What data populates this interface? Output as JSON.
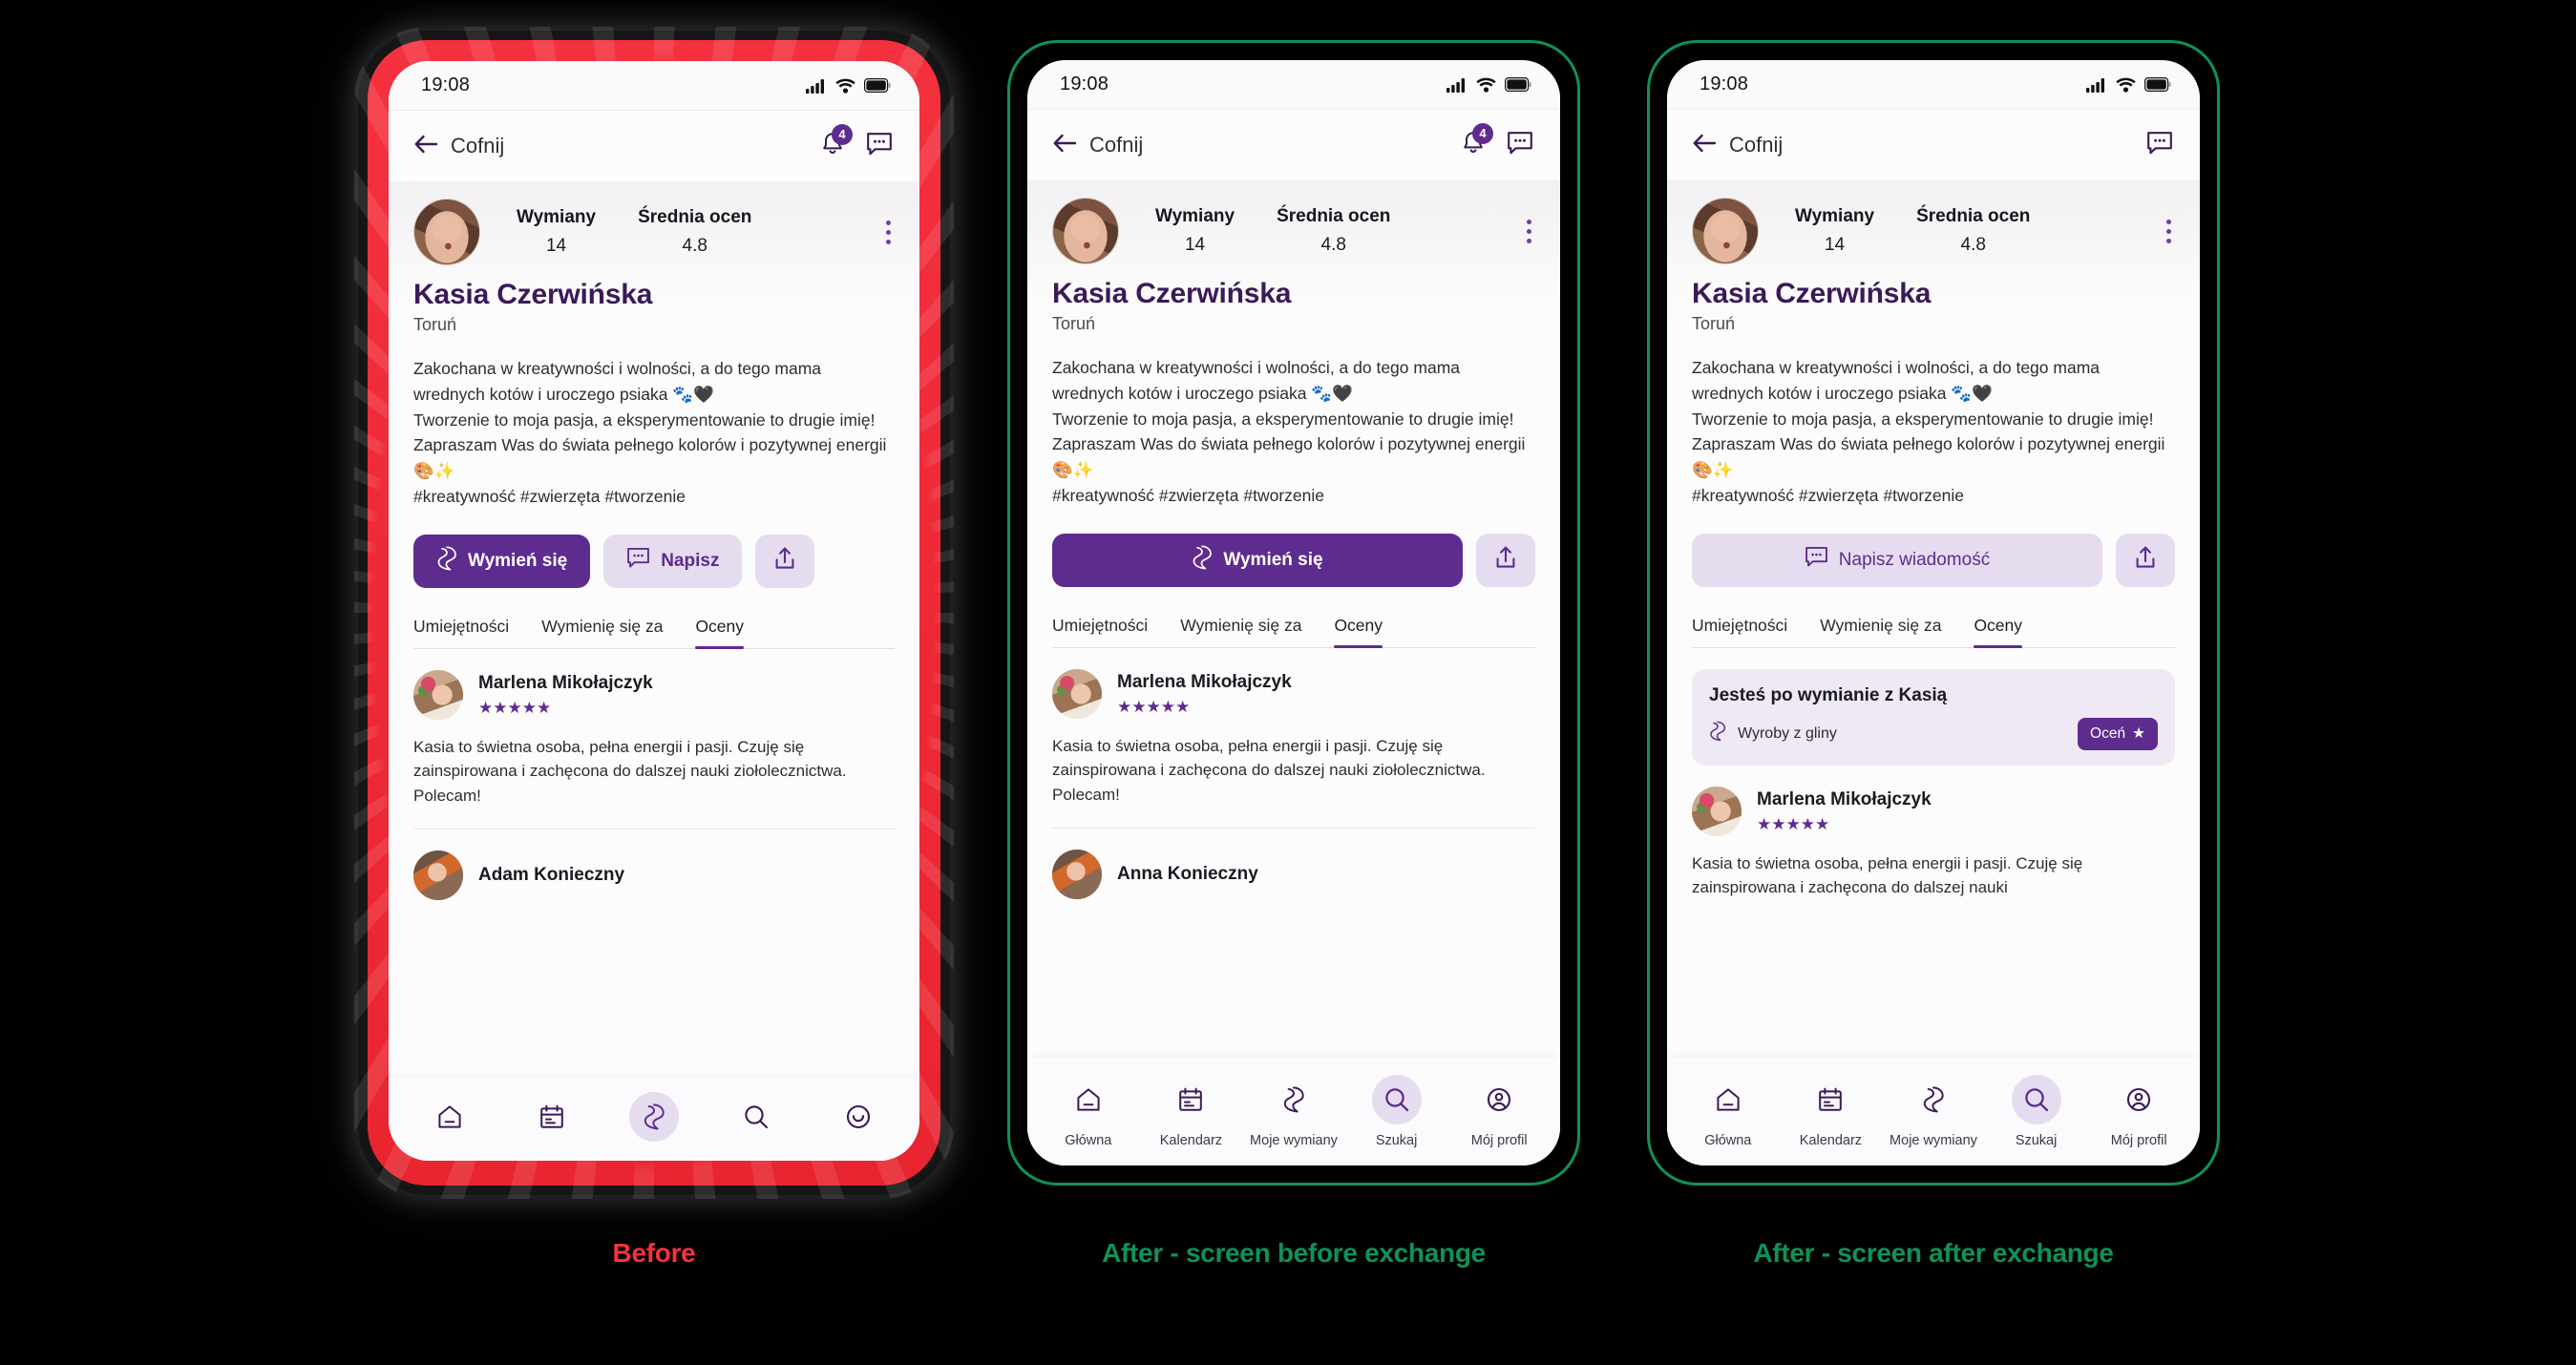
{
  "captions": {
    "before": "Before",
    "after_before_exchange": "After - screen before exchange",
    "after_after_exchange": "After - screen after exchange",
    "color_red": "#f5333f",
    "color_green": "#0f9257"
  },
  "status": {
    "time": "19:08",
    "signal_icon": "cellular-signal-icon",
    "wifi_icon": "wifi-icon",
    "battery_icon": "battery-icon"
  },
  "appbar": {
    "back_label": "Cofnij",
    "back_icon": "arrow-left-icon",
    "bell_icon": "bell-icon",
    "bell_badge": "4",
    "message_icon": "message-icon"
  },
  "profile": {
    "avatar": "kasia-avatar",
    "stats": [
      {
        "label": "Wymiany",
        "value": "14"
      },
      {
        "label": "Średnia ocen",
        "value": "4.8"
      }
    ],
    "kebab_icon": "more-vertical-icon",
    "name": "Kasia Czerwińska",
    "city": "Toruń",
    "bio": "Zakochana w kreatywności i wolności, a do tego mama wrednych kotów i uroczego psiaka 🐾🖤\nTworzenie to moja pasja, a eksperymentowanie to drugie imię! Zapraszam Was do świata pełnego kolorów i pozytywnej energii 🎨✨\n#kreatywność #zwierzęta #tworzenie"
  },
  "actions": {
    "exchange_label": "Wymień się",
    "exchange_icon": "exchange-icon",
    "write_label": "Napisz",
    "write_long_label": "Napisz wiadomość",
    "write_icon": "message-icon",
    "share_icon": "share-icon"
  },
  "tabs": {
    "items": [
      {
        "label": "Umiejętności",
        "active": false
      },
      {
        "label": "Wymienię się za",
        "active": false
      },
      {
        "label": "Oceny",
        "active": true
      }
    ]
  },
  "exchange_prompt": {
    "title": "Jesteś po wymianie z Kasią",
    "item_label": "Wyroby z gliny",
    "item_icon": "exchange-icon",
    "rate_label": "Oceń",
    "rate_icon": "star-icon"
  },
  "reviews": {
    "phone1": [
      {
        "avatar": "marlena-avatar",
        "name": "Marlena Mikołajczyk",
        "stars": 5,
        "text": "Kasia to świetna osoba, pełna energii i pasji. Czuję się zainspirowana i zachęcona do dalszej nauki ziołolecznictwa. Polecam!"
      },
      {
        "avatar": "adam-avatar",
        "name": "Adam Konieczny",
        "stars": 5,
        "text": ""
      }
    ],
    "phone2": [
      {
        "avatar": "marlena-avatar",
        "name": "Marlena Mikołajczyk",
        "stars": 5,
        "text": "Kasia to świetna osoba, pełna energii i pasji. Czuję się zainspirowana i zachęcona do dalszej nauki ziołolecznictwa. Polecam!"
      },
      {
        "avatar": "anna-avatar",
        "name": "Anna Konieczny",
        "stars": 5,
        "text": ""
      }
    ],
    "phone3": [
      {
        "avatar": "marlena-avatar",
        "name": "Marlena Mikołajczyk",
        "stars": 5,
        "text": "Kasia to świetna osoba, pełna energii i pasji. Czuję się zainspirowana i zachęcona do dalszej nauki"
      }
    ]
  },
  "bottomnav": {
    "items": [
      {
        "label": "Główna",
        "icon": "home-icon",
        "selected": false
      },
      {
        "label": "Kalendarz",
        "icon": "calendar-icon",
        "selected": false
      },
      {
        "label": "Moje wymiany",
        "icon": "exchange-icon",
        "selected": false
      },
      {
        "label": "Szukaj",
        "icon": "search-icon",
        "selected": false
      },
      {
        "label": "Mój profil",
        "icon": "profile-icon",
        "selected": false
      }
    ],
    "phone1_selected_index": 2,
    "phone23_selected_index": 3,
    "phone1_icons": [
      "home-icon",
      "calendar-icon",
      "exchange-icon",
      "search-icon",
      "smiley-icon"
    ]
  },
  "colors": {
    "brand_purple": "#5e2b8e",
    "brand_purple_dark": "#3b1a57",
    "brand_purple_light": "#e6dcf0",
    "frame_red": "#ee2a38",
    "frame_green": "#0f9257"
  }
}
